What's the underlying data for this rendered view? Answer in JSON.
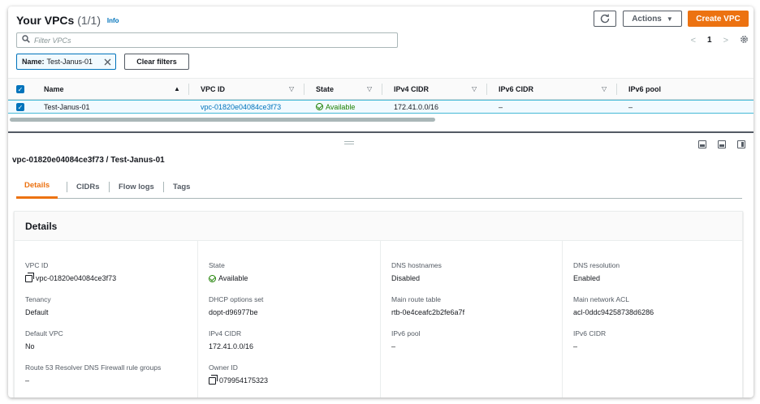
{
  "header": {
    "title": "Your VPCs",
    "count": "(1/1)",
    "info": "Info",
    "refresh_icon": "refresh-icon",
    "actions_label": "Actions",
    "create_label": "Create VPC",
    "accent": "#ec7211"
  },
  "filter": {
    "placeholder": "Filter VPCs",
    "token_key": "Name:",
    "token_value": "Test-Janus-01",
    "clear_label": "Clear filters"
  },
  "pager": {
    "prev": "<",
    "page": "1",
    "next": ">"
  },
  "table": {
    "columns": [
      "Name",
      "VPC ID",
      "State",
      "IPv4 CIDR",
      "IPv6 CIDR",
      "IPv6 pool"
    ],
    "rows": [
      {
        "name": "Test-Janus-01",
        "vpc_id": "vpc-01820e04084ce3f73",
        "state": "Available",
        "ipv4": "172.41.0.0/16",
        "ipv6": "–",
        "pool": "–"
      }
    ]
  },
  "split": {
    "title": "vpc-01820e04084ce3f73 / Test-Janus-01",
    "tabs": [
      "Details",
      "CIDRs",
      "Flow logs",
      "Tags"
    ]
  },
  "details": {
    "title": "Details",
    "col1": [
      {
        "k": "VPC ID",
        "v": "vpc-01820e04084ce3f73"
      },
      {
        "k": "Tenancy",
        "v": "Default"
      },
      {
        "k": "Default VPC",
        "v": "No"
      },
      {
        "k": "Route 53 Resolver DNS Firewall rule groups",
        "v": "–"
      }
    ],
    "col2": [
      {
        "k": "State",
        "v": "Available"
      },
      {
        "k": "DHCP options set",
        "v": "dopt-d96977be"
      },
      {
        "k": "IPv4 CIDR",
        "v": "172.41.0.0/16"
      },
      {
        "k": "Owner ID",
        "v": "079954175323"
      }
    ],
    "col3": [
      {
        "k": "DNS hostnames",
        "v": "Disabled"
      },
      {
        "k": "Main route table",
        "v": "rtb-0e4ceafc2b2fe6a7f"
      },
      {
        "k": "IPv6 pool",
        "v": "–"
      }
    ],
    "col4": [
      {
        "k": "DNS resolution",
        "v": "Enabled"
      },
      {
        "k": "Main network ACL",
        "v": "acl-0ddc94258738d6286"
      },
      {
        "k": "IPv6 CIDR",
        "v": "–"
      }
    ]
  }
}
